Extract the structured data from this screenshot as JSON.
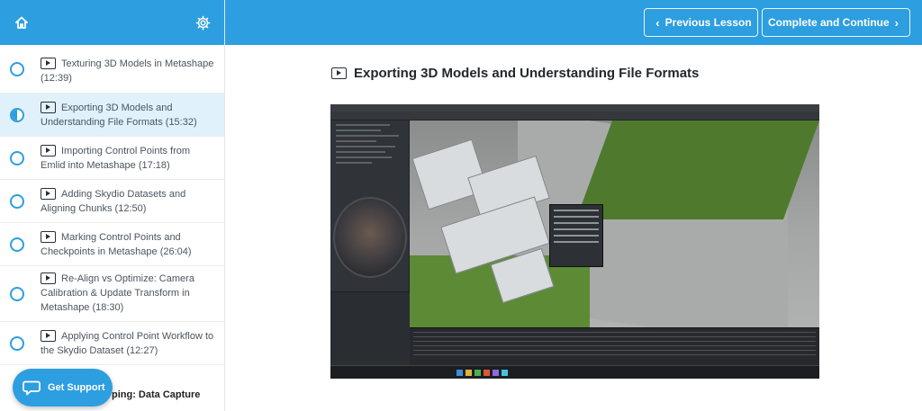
{
  "header": {
    "home_icon": "home-icon",
    "settings_icon": "gear-icon",
    "prev_label": "Previous Lesson",
    "next_label": "Complete and Continue",
    "accent": "#2d9ee0"
  },
  "sidebar": {
    "lessons": [
      {
        "label": "Texturing 3D Models in Metashape (12:39)",
        "status": "incomplete"
      },
      {
        "label": "Exporting 3D Models and Understanding File Formats (15:32)",
        "status": "in-progress"
      },
      {
        "label": "Importing Control Points from Emlid into Metashape (17:18)",
        "status": "incomplete"
      },
      {
        "label": "Adding Skydio Datasets and Aligning Chunks (12:50)",
        "status": "incomplete"
      },
      {
        "label": "Marking Control Points and Checkpoints in Metashape (26:04)",
        "status": "incomplete"
      },
      {
        "label": "Re-Align vs Optimize: Camera Calibration & Update Transform in Metashape (18:30)",
        "status": "incomplete"
      },
      {
        "label": "Applying Control Point Workflow to the Skydio Dataset (12:27)",
        "status": "incomplete"
      }
    ],
    "next_section": "ping: Data Capture"
  },
  "support": {
    "label": "Get Support",
    "icon": "chat-bubble-icon"
  },
  "main": {
    "title": "Exporting 3D Models and Understanding File Formats"
  }
}
